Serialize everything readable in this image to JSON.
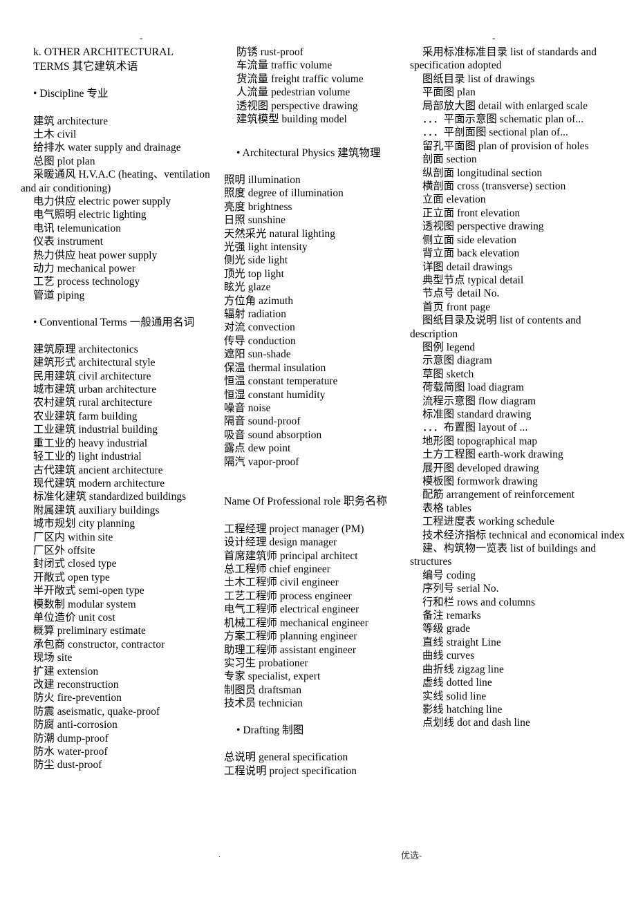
{
  "page": {
    "header_tick_left": "-",
    "header_tick_right": "-",
    "footer_dot": ".",
    "footer_mark": "优选-"
  },
  "column1": {
    "title_line1": "k. OTHER ARCHITECTURAL",
    "title_line2": "TERMS 其它建筑术语",
    "section_discipline": "• Discipline 专业",
    "discipline_items": [
      "建筑 architecture",
      "土木 civil",
      "给排水 water supply and drainage",
      "总图 plot plan",
      "采暖通风 H.V.A.C (heating、ventilation and air conditioning)",
      "电力供应 electric power supply",
      "电气照明 electric lighting",
      "电讯 telemunication",
      "仪表 instrument",
      "热力供应 heat power supply",
      "动力 mechanical power",
      "工艺 process technology",
      "管道 piping"
    ],
    "section_conventional": "• Conventional Terms 一般通用名词",
    "conventional_items": [
      "建筑原理 architectonics",
      "建筑形式 architectural style",
      "民用建筑 civil architecture",
      "城市建筑 urban architecture",
      "农村建筑 rural architecture",
      "农业建筑 farm building",
      "工业建筑 industrial building",
      "重工业的 heavy industrial",
      "轻工业的 light industrial",
      "古代建筑 ancient architecture",
      "现代建筑 modern architecture",
      "标准化建筑 standardized buildings",
      "附属建筑 auxiliary buildings",
      "城市规划 city planning",
      "厂区内 within site",
      "厂区外 offsite",
      "封闭式 closed type",
      "开敞式 open type",
      "半开敞式 semi-open type",
      "模数制 modular system",
      "单位造价 unit cost",
      "概算 preliminary estimate",
      "承包商 constructor, contractor",
      "现场 site",
      "扩建 extension",
      "改建 reconstruction",
      "防火 fire-prevention",
      "防震 aseismatic, quake-proof",
      "防腐 anti-corrosion",
      "防潮 dump-proof",
      "防水 water-proof",
      "防尘 dust-proof"
    ]
  },
  "column2": {
    "continued_items": [
      "防锈 rust-proof",
      "车流量 traffic volume",
      "货流量 freight traffic volume",
      "人流量 pedestrian volume",
      "透视图 perspective drawing",
      "建筑模型 building model"
    ],
    "section_physics": "• Architectural Physics 建筑物理",
    "physics_items": [
      "照明 illumination",
      "照度 degree of illumination",
      "亮度 brightness",
      "日照 sunshine",
      "天然采光 natural lighting",
      "光强 light intensity",
      "侧光 side light",
      "顶光 top light",
      "眩光 glaze",
      "方位角 azimuth",
      "辐射 radiation",
      "对流 convection",
      "传导 conduction",
      "遮阳 sun-shade",
      "保温 thermal insulation",
      "恒温 constant temperature",
      "恒湿 constant humidity",
      "噪音 noise",
      "隔音 sound-proof",
      "吸音 sound absorption",
      "露点 dew point",
      "隔汽 vapor-proof"
    ],
    "section_roles": "Name Of Professional role 职务名称",
    "role_items": [
      "工程经理 project manager (PM)",
      "设计经理 design manager",
      "首席建筑师 principal architect",
      "总工程师 chief engineer",
      "土木工程师 civil engineer",
      "工艺工程师 process engineer",
      "电气工程师 electrical engineer",
      "机械工程师 mechanical engineer",
      "方案工程师 planning engineer",
      "助理工程师 assistant engineer",
      "实习生 probationer",
      "专家 specialist, expert",
      "制图员 draftsman",
      "技术员 technician"
    ],
    "section_drafting": "• Drafting 制图",
    "drafting_items": [
      "总说明 general specification",
      "工程说明 project specification"
    ]
  },
  "column3": {
    "items": [
      "采用标准标准目录 list of standards and specification adopted",
      "图纸目录 list of drawings",
      "平面图 plan",
      "局部放大图 detail with enlarged scale",
      "．．．平面示意图 schematic plan of...",
      "．．．平剖面图 sectional plan of...",
      "留孔平面图 plan of provision of holes",
      "剖面 section",
      "纵剖面 longitudinal section",
      "横剖面 cross (transverse) section",
      "立面 elevation",
      "正立面 front elevation",
      "透视图 perspective drawing",
      "侧立面 side elevation",
      "背立面 back elevation",
      "详图 detail drawings",
      "典型节点 typical detail",
      "节点号 detail No.",
      "首页 front page",
      "图纸目录及说明 list of contents and description",
      "图例 legend",
      "示意图 diagram",
      "草图 sketch",
      "荷载简图 load diagram",
      "流程示意图 flow diagram",
      "标准图 standard drawing",
      "．．．布置图 layout of ...",
      "地形图 topographical map",
      "土方工程图 earth-work drawing",
      "展开图 developed drawing",
      "模板图 formwork drawing",
      "配筋 arrangement of reinforcement",
      "表格 tables",
      "工程进度表 working schedule",
      "技术经济指标 technical and economical index",
      "建、构筑物一览表 list of buildings and structures",
      "编号 coding",
      "序列号 serial No.",
      "行和栏 rows and columns",
      "备注 remarks",
      "等级 grade",
      "直线 straight Line",
      "曲线 curves",
      "曲折线 zigzag line",
      "虚线 dotted line",
      "实线 solid line",
      "影线 hatching line",
      "点划线 dot and dash line"
    ]
  }
}
